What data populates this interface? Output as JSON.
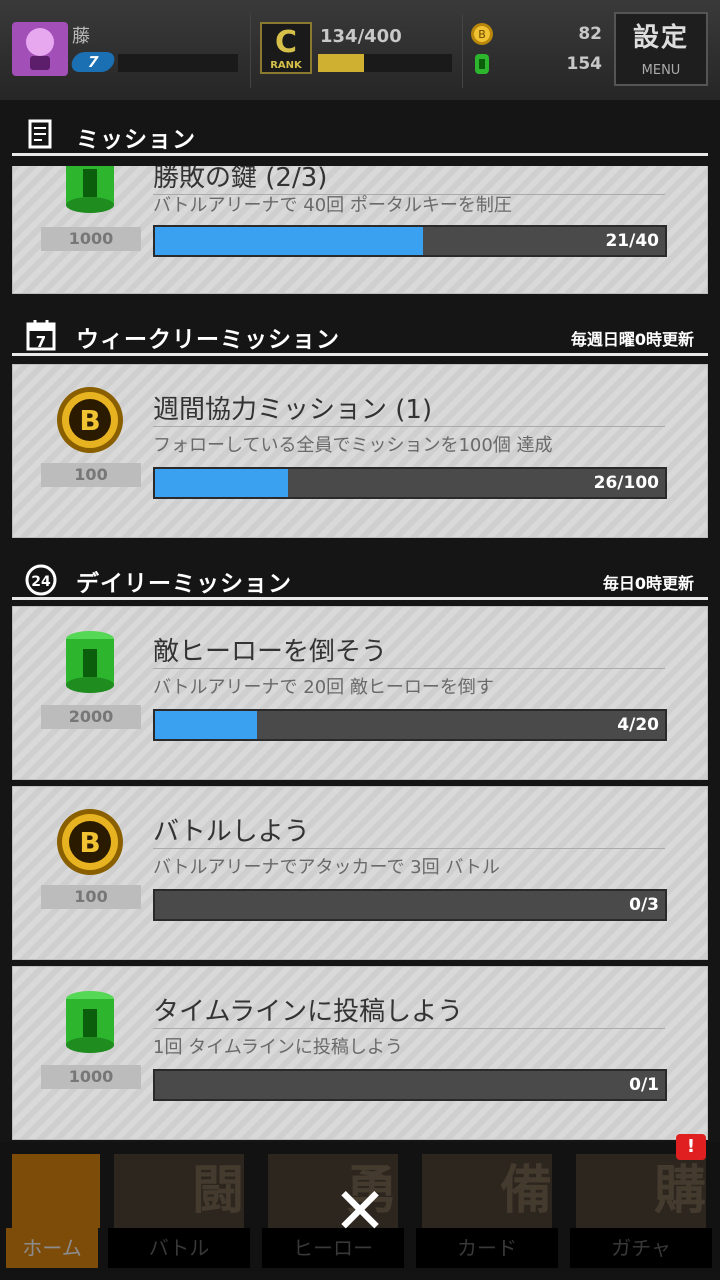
{
  "status": {
    "player_name": "藤",
    "level": "7",
    "rank_icon_letter": "C",
    "rank_icon_caption": "RANK",
    "stamina": "134/400",
    "stamina_level": 0.34,
    "gold_coins": "82",
    "green_coins": "154",
    "menu_kanji": "設定",
    "menu_label": "MENU"
  },
  "panel": {
    "title": "ミッション",
    "sections": [
      {
        "title": "ウィークリーミッション",
        "note": "毎週日曜0時更新"
      },
      {
        "title": "デイリーミッション",
        "note": "毎日0時更新"
      }
    ],
    "partial_card": {
      "title": "勝敗の鍵 (2/3)",
      "reward_icon": "green-can-icon",
      "reward": "1000",
      "description": "バトルアリーナで 40回 ポータルキーを制圧",
      "progress": "21/40",
      "progress_fraction": 0.525
    },
    "weekly_cards": [
      {
        "title": "週間協力ミッション (1)",
        "reward_icon": "gold-coin-icon",
        "reward": "100",
        "description": "フォローしている全員でミッションを100個 達成",
        "progress": "26/100",
        "progress_fraction": 0.26
      }
    ],
    "daily_cards": [
      {
        "title": "敵ヒーローを倒そう",
        "reward_icon": "green-can-icon",
        "reward": "2000",
        "description": "バトルアリーナで 20回 敵ヒーローを倒す",
        "progress": "4/20",
        "progress_fraction": 0.2
      },
      {
        "title": "バトルしよう",
        "reward_icon": "gold-coin-icon",
        "reward": "100",
        "description": "バトルアリーナでアタッカーで 3回 バトル",
        "progress": "0/3",
        "progress_fraction": 0
      },
      {
        "title": "タイムラインに投稿しよう",
        "reward_icon": "green-can-icon",
        "reward": "1000",
        "description": "1回 タイムラインに投稿しよう",
        "progress": "0/1",
        "progress_fraction": 0
      }
    ]
  },
  "bottom_nav": {
    "items": [
      {
        "kanji": "",
        "label": "ホーム",
        "icon": "home-return-icon"
      },
      {
        "kanji": "闘",
        "label": "バトル",
        "icon": "gamepad-icon"
      },
      {
        "kanji": "勇",
        "label": "ヒーロー",
        "icon": "hero-icon"
      },
      {
        "kanji": "備",
        "label": "カード",
        "icon": "cards-icon"
      },
      {
        "kanji": "購",
        "label": "ガチャ",
        "icon": "gacha-icon"
      }
    ],
    "notification_badge": "!",
    "close_glyph": "✕"
  },
  "colors": {
    "progress_fill": "#3aa0f0",
    "active_nav": "#e58a12",
    "stamina_fill": "#d0b030"
  }
}
